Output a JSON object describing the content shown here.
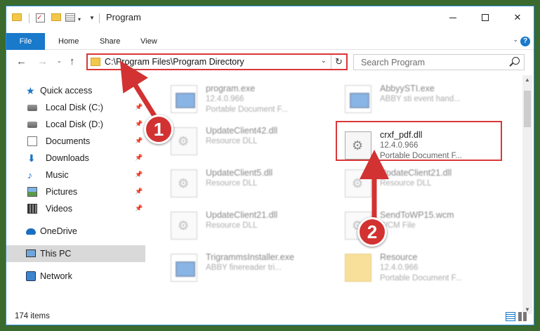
{
  "window": {
    "title": "Program",
    "minimize_label": "—",
    "maximize_label": "",
    "close_label": "✕"
  },
  "ribbon": {
    "file": "File",
    "home": "Home",
    "share": "Share",
    "view": "View"
  },
  "nav": {
    "back": "←",
    "forward": "→",
    "recent": "⌄",
    "up": "↑",
    "address": "C:\\Program Files\\Program Directory",
    "refresh": "↻",
    "search_placeholder": "Search Program"
  },
  "sidebar": {
    "items": [
      {
        "label": "Quick access",
        "icon": "star-icon"
      },
      {
        "label": "Local Disk (C:)",
        "icon": "disk-icon"
      },
      {
        "label": "Local Disk (D:)",
        "icon": "disk-icon"
      },
      {
        "label": "Documents",
        "icon": "documents-icon"
      },
      {
        "label": "Downloads",
        "icon": "download-icon"
      },
      {
        "label": "Music",
        "icon": "music-icon"
      },
      {
        "label": "Pictures",
        "icon": "pictures-icon"
      },
      {
        "label": "Videos",
        "icon": "videos-icon"
      },
      {
        "label": "OneDrive",
        "icon": "cloud-icon"
      },
      {
        "label": "This PC",
        "icon": "computer-icon"
      },
      {
        "label": "Network",
        "icon": "network-icon"
      }
    ]
  },
  "files": [
    {
      "name": "program.exe",
      "line1": "12.4.0.966",
      "line2": "Portable Document F...",
      "icon": "exe-icon"
    },
    {
      "name": "AbbyySTI.exe",
      "line1": "ABBY sti event hand...",
      "line2": "",
      "icon": "exe-icon"
    },
    {
      "name": "UpdateClient42.dll",
      "line1": "Resource DLL",
      "line2": "",
      "icon": "dll-icon"
    },
    {
      "name": "crxf_pdf.dll",
      "line1": "12.4.0.966",
      "line2": "Portable Document F...",
      "icon": "dll-icon"
    },
    {
      "name": "UpdateClient5.dll",
      "line1": "Resource DLL",
      "line2": "",
      "icon": "dll-icon"
    },
    {
      "name": "UpdateClient21.dll",
      "line1": "Resource DLL",
      "line2": "",
      "icon": "dll-icon"
    },
    {
      "name": "UpdateClient21.dll",
      "line1": "Resource DLL",
      "line2": "",
      "icon": "dll-icon"
    },
    {
      "name": "SendToWP15.wcm",
      "line1": "WCM File",
      "line2": "",
      "icon": "dll-icon"
    },
    {
      "name": "TrigrammsInstaller.exe",
      "line1": "ABBY finereader tri...",
      "line2": "",
      "icon": "exe-icon"
    },
    {
      "name": "Resource",
      "line1": "12.4.0.966",
      "line2": "Portable Document F...",
      "icon": "folder-icon"
    }
  ],
  "status": {
    "count": "174 items"
  },
  "annotations": {
    "step1": "1",
    "step2": "2",
    "color": "#d9373a"
  }
}
